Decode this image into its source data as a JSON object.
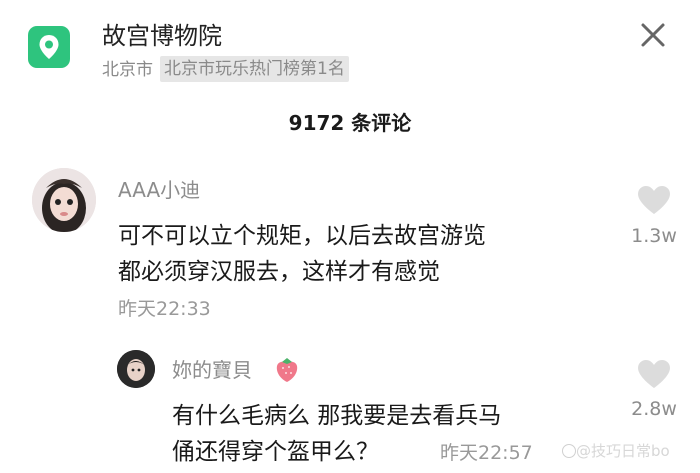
{
  "header": {
    "poi_name": "故宫博物院",
    "city": "北京市",
    "rank": "北京市玩乐热门榜第1名"
  },
  "comment_count": "9172 条评论",
  "comments": [
    {
      "username": "AAA小迪",
      "lines": [
        "可不可以立个规矩，以后去故宫游览",
        "都必须穿汉服去，这样才有感觉"
      ],
      "time": "昨天22:33",
      "likes": "1.3w"
    }
  ],
  "reply": {
    "username": "妳的寶貝",
    "lines": [
      "有什么毛病么 那我要是去看兵马",
      "俑还得穿个盔甲么？"
    ],
    "time": "昨天22:57",
    "likes": "2.8w"
  },
  "watermark": "@技巧日常bo",
  "colors": {
    "accent": "#2ec47e",
    "strawberry": "#f0788a"
  }
}
